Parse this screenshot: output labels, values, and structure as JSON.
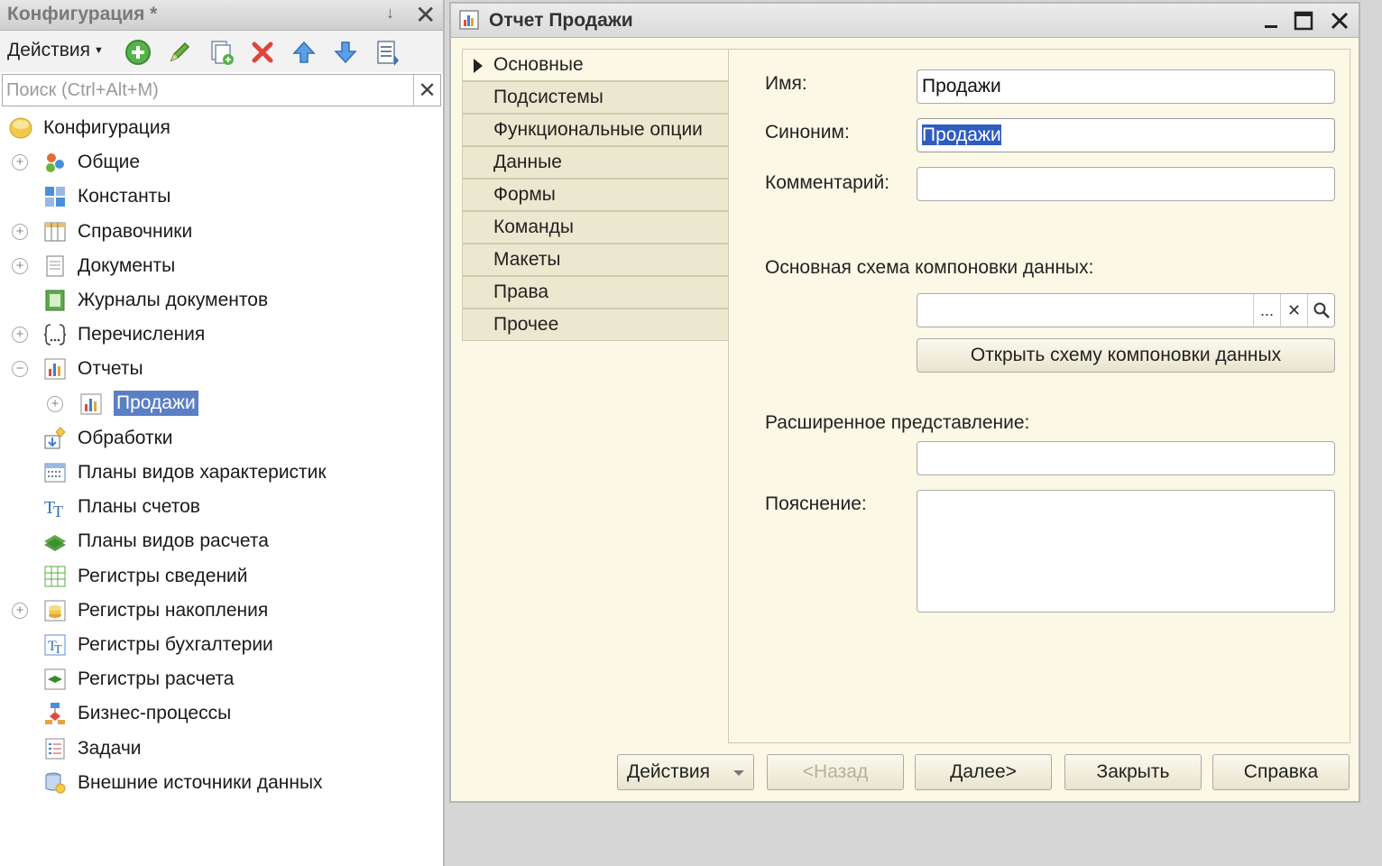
{
  "left_panel": {
    "title": "Конфигурация *",
    "actions_label": "Действия",
    "search_placeholder": "Поиск (Ctrl+Alt+M)",
    "tree": [
      {
        "label": "Конфигурация",
        "icon": "configuration-icon",
        "expander": "",
        "indent": 0
      },
      {
        "label": "Общие",
        "icon": "common-icon",
        "expander": "plus",
        "indent": 1
      },
      {
        "label": "Константы",
        "icon": "constants-icon",
        "expander": "",
        "indent": 1
      },
      {
        "label": "Справочники",
        "icon": "catalogs-icon",
        "expander": "plus",
        "indent": 1
      },
      {
        "label": "Документы",
        "icon": "documents-icon",
        "expander": "plus",
        "indent": 1
      },
      {
        "label": "Журналы документов",
        "icon": "document-journals-icon",
        "expander": "",
        "indent": 1
      },
      {
        "label": "Перечисления",
        "icon": "enumerations-icon",
        "expander": "plus",
        "indent": 1
      },
      {
        "label": "Отчеты",
        "icon": "reports-icon",
        "expander": "minus",
        "indent": 1
      },
      {
        "label": "Продажи",
        "icon": "report-icon",
        "expander": "plus",
        "indent": 2,
        "selected": true
      },
      {
        "label": "Обработки",
        "icon": "data-processors-icon",
        "expander": "",
        "indent": 1
      },
      {
        "label": "Планы видов характеристик",
        "icon": "characteristic-types-icon",
        "expander": "",
        "indent": 1
      },
      {
        "label": "Планы счетов",
        "icon": "chart-of-accounts-icon",
        "expander": "",
        "indent": 1
      },
      {
        "label": "Планы видов расчета",
        "icon": "calculation-types-icon",
        "expander": "",
        "indent": 1
      },
      {
        "label": "Регистры сведений",
        "icon": "information-registers-icon",
        "expander": "",
        "indent": 1
      },
      {
        "label": "Регистры накопления",
        "icon": "accumulation-registers-icon",
        "expander": "plus",
        "indent": 1
      },
      {
        "label": "Регистры бухгалтерии",
        "icon": "accounting-registers-icon",
        "expander": "",
        "indent": 1
      },
      {
        "label": "Регистры расчета",
        "icon": "calculation-registers-icon",
        "expander": "",
        "indent": 1
      },
      {
        "label": "Бизнес-процессы",
        "icon": "business-processes-icon",
        "expander": "",
        "indent": 1
      },
      {
        "label": "Задачи",
        "icon": "tasks-icon",
        "expander": "",
        "indent": 1
      },
      {
        "label": "Внешние источники данных",
        "icon": "external-data-sources-icon",
        "expander": "",
        "indent": 1
      }
    ]
  },
  "doc_window": {
    "title": "Отчет Продажи",
    "nav_tabs": [
      "Основные",
      "Подсистемы",
      "Функциональные опции",
      "Данные",
      "Формы",
      "Команды",
      "Макеты",
      "Права",
      "Прочее"
    ],
    "active_tab": 0,
    "form": {
      "name_label": "Имя:",
      "name_value": "Продажи",
      "synonym_label": "Синоним:",
      "synonym_value": "Продажи",
      "comment_label": "Комментарий:",
      "comment_value": "",
      "schema_label": "Основная схема компоновки данных:",
      "schema_value": "",
      "schema_select": "...",
      "open_schema_label": "Открыть схему компоновки данных",
      "ext_presentation_label": "Расширенное представление:",
      "ext_presentation_value": "",
      "explanation_label": "Пояснение:",
      "explanation_value": ""
    },
    "buttons": {
      "actions": "Действия",
      "back": "<Назад",
      "next": "Далее>",
      "close": "Закрыть",
      "help": "Справка"
    }
  },
  "colors": {
    "window_bg": "#fbf8e6",
    "selection": "#5b7fc4",
    "tab_bg": "#ece8d0"
  }
}
